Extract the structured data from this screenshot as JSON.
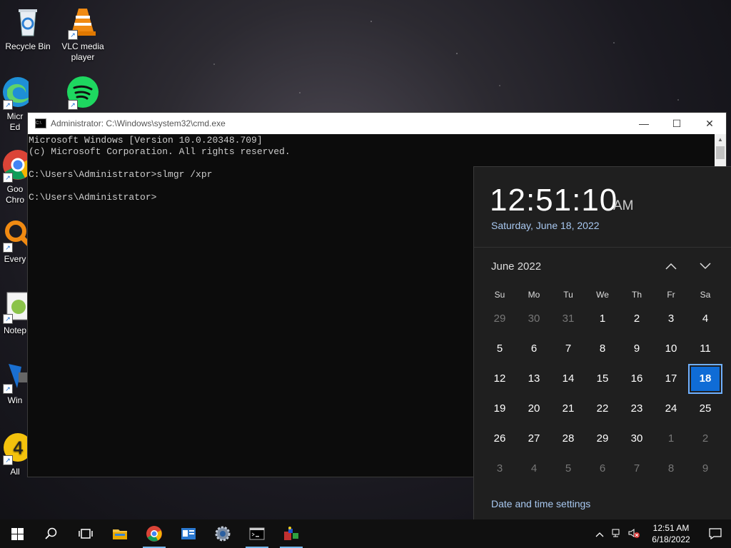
{
  "desktop": {
    "icons": [
      {
        "label": "Recycle Bin"
      },
      {
        "label": "VLC media player"
      },
      {
        "label": "Micr Ed"
      },
      {
        "label": ""
      },
      {
        "label": "Goo Chro"
      },
      {
        "label": "Every"
      },
      {
        "label": "Notep"
      },
      {
        "label": "Win"
      },
      {
        "label": "All"
      }
    ]
  },
  "cmd": {
    "title": "Administrator: C:\\Windows\\system32\\cmd.exe",
    "lines": [
      "Microsoft Windows [Version 10.0.20348.709]",
      "(c) Microsoft Corporation. All rights reserved.",
      "",
      "C:\\Users\\Administrator>slmgr /xpr",
      "",
      "C:\\Users\\Administrator>"
    ]
  },
  "clock_flyout": {
    "time": "12:51:10",
    "ampm": "AM",
    "date": "Saturday, June 18, 2022",
    "month_label": "June 2022",
    "weekdays": [
      "Su",
      "Mo",
      "Tu",
      "We",
      "Th",
      "Fr",
      "Sa"
    ],
    "weeks": [
      [
        "29",
        "30",
        "31",
        "1",
        "2",
        "3",
        "4"
      ],
      [
        "5",
        "6",
        "7",
        "8",
        "9",
        "10",
        "11"
      ],
      [
        "12",
        "13",
        "14",
        "15",
        "16",
        "17",
        "18"
      ],
      [
        "19",
        "20",
        "21",
        "22",
        "23",
        "24",
        "25"
      ],
      [
        "26",
        "27",
        "28",
        "29",
        "30",
        "1",
        "2"
      ],
      [
        "3",
        "4",
        "5",
        "6",
        "7",
        "8",
        "9"
      ]
    ],
    "dim_cells": [
      "0-0",
      "0-1",
      "0-2",
      "4-5",
      "4-6",
      "5-0",
      "5-1",
      "5-2",
      "5-3",
      "5-4",
      "5-5",
      "5-6"
    ],
    "today_cell": "2-6",
    "settings_link": "Date and time settings",
    "accent": "#0f6cd6"
  },
  "taskbar": {
    "items": [
      "start-icon",
      "search-icon",
      "task-view-icon",
      "file-explorer-icon",
      "chrome-icon",
      "server-manager-icon",
      "settings-icon",
      "cmd-icon",
      "paint-icon"
    ],
    "tray_time": "12:51 AM",
    "tray_date": "6/18/2022"
  }
}
